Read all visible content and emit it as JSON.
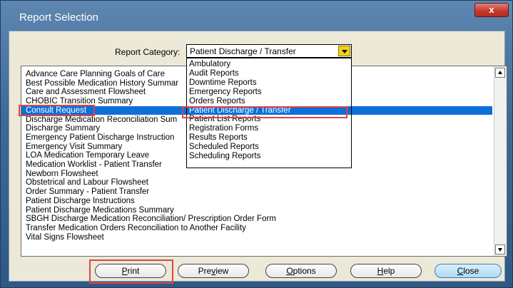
{
  "window": {
    "title": "Report Selection",
    "close_label": "x"
  },
  "report_category": {
    "label": "Report Category:",
    "selected": "Patient Discharge / Transfer",
    "options": [
      "Ambulatory",
      "Audit Reports",
      "Downtime Reports",
      "Emergency Reports",
      "Orders Reports",
      "Patient Discharge / Transfer",
      "Patient List Reports",
      "Registration Forms",
      "Results Reports",
      "Scheduled Reports",
      "Scheduling Reports"
    ]
  },
  "reports": [
    "Advance Care Planning Goals of Care",
    "Best Possible Medication History Summar",
    "Care and Assessment Flowsheet",
    "CHOBIC Transition Summary",
    "Consult Request",
    "Discharge Medication Reconciliation Sum",
    "Discharge Summary",
    "Emergency Patient Discharge Instruction",
    "Emergency Visit Summary",
    "LOA Medication Temporary Leave",
    "Medication Worklist - Patient Transfer",
    "Newborn Flowsheet",
    "Obstetrical and Labour Flowsheet",
    "Order Summary - Patient Transfer",
    "Patient Discharge Instructions",
    "Patient Discharge Medications Summary",
    "SBGH Discharge Medication Reconciliation/ Prescription Order Form",
    "Transfer Medication Orders Reconciliation to Another Facility",
    "Vital Signs Flowsheet"
  ],
  "selected_report": "Consult Request",
  "buttons": {
    "print": {
      "label": "Print",
      "mn": "P",
      "rest": "rint"
    },
    "preview": {
      "label": "Preview",
      "pre": "Pre",
      "mn": "v",
      "rest": "iew"
    },
    "options": {
      "label": "Options",
      "mn": "O",
      "rest": "ptions"
    },
    "help": {
      "label": "Help",
      "mn": "H",
      "rest": "elp"
    },
    "close": {
      "label": "Close",
      "mn": "C",
      "rest": "lose"
    }
  },
  "colors": {
    "selection": "#0d6fd8",
    "highlight": "#e2443f",
    "combo_button": "#f5d11a"
  }
}
